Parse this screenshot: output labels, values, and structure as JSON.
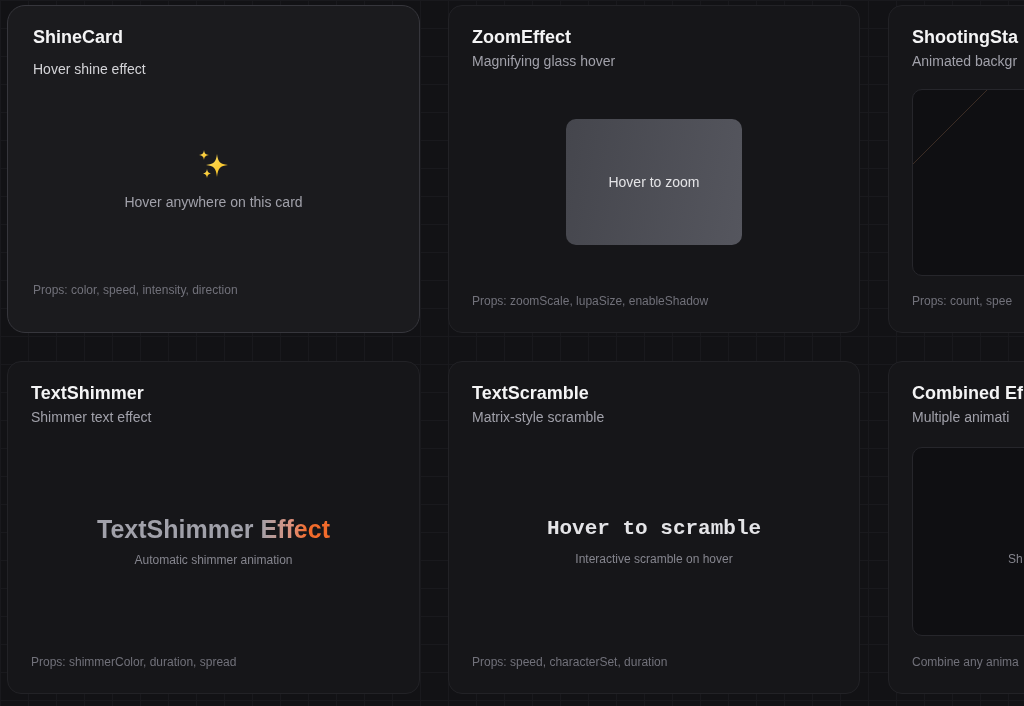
{
  "cards": [
    {
      "kind": "shine",
      "title": "ShineCard",
      "subtitle": "Hover shine effect",
      "hovered": true,
      "caption": "Hover anywhere on this card",
      "props": "Props: color, speed, intensity, direction"
    },
    {
      "kind": "zoom",
      "title": "ZoomEffect",
      "subtitle": "Magnifying glass hover",
      "hovered": false,
      "caption": "Hover to zoom",
      "props": "Props: zoomScale, lupaSize, enableShadow"
    },
    {
      "kind": "stars",
      "title": "ShootingSta",
      "subtitle": "Animated backgr",
      "hovered": false,
      "props": "Props: count, spee"
    },
    {
      "kind": "shimmer",
      "title": "TextShimmer",
      "subtitle": "Shimmer text effect",
      "hovered": false,
      "headline": "TextShimmer Effect",
      "caption": "Automatic shimmer animation",
      "props": "Props: shimmerColor, duration, spread"
    },
    {
      "kind": "scramble",
      "title": "TextScramble",
      "subtitle": "Matrix-style scramble",
      "hovered": false,
      "headline": "Hover to scramble",
      "caption": "Interactive scramble on hover",
      "props": "Props: speed, characterSet, duration"
    },
    {
      "kind": "combined",
      "title": "Combined Ef",
      "subtitle": "Multiple animati",
      "hovered": false,
      "caption": "Sh",
      "props": "Combine any anima"
    }
  ]
}
